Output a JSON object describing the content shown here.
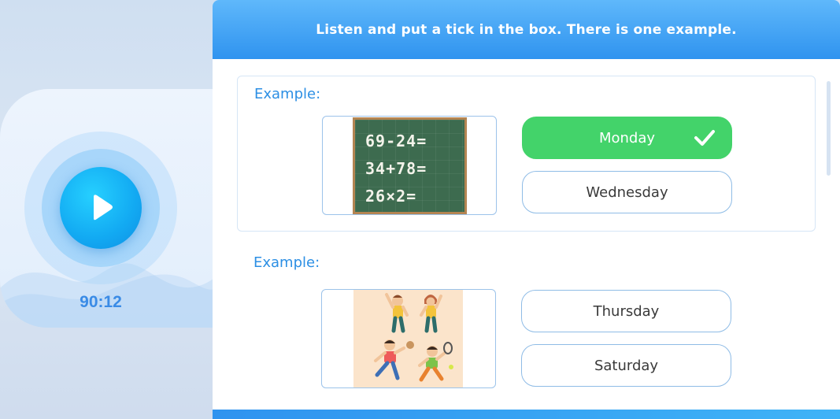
{
  "player": {
    "timer": "90:12",
    "play_icon": "play-icon"
  },
  "header": {
    "title": "Listen and put a tick in the box. There is one example."
  },
  "questions": [
    {
      "label": "Example:",
      "image_icon": "chalkboard-math-image",
      "chalkboard_lines": [
        "69-24=",
        "34+78=",
        "26×2="
      ],
      "options": [
        {
          "label": "Monday",
          "selected": true
        },
        {
          "label": "Wednesday",
          "selected": false
        }
      ]
    },
    {
      "label": "Example:",
      "image_icon": "children-exercising-image",
      "options": [
        {
          "label": "Thursday",
          "selected": false
        },
        {
          "label": "Saturday",
          "selected": false
        }
      ]
    }
  ],
  "colors": {
    "accent": "#2f93ef",
    "selected": "#43d36a",
    "label_blue": "#2c8fe4"
  }
}
